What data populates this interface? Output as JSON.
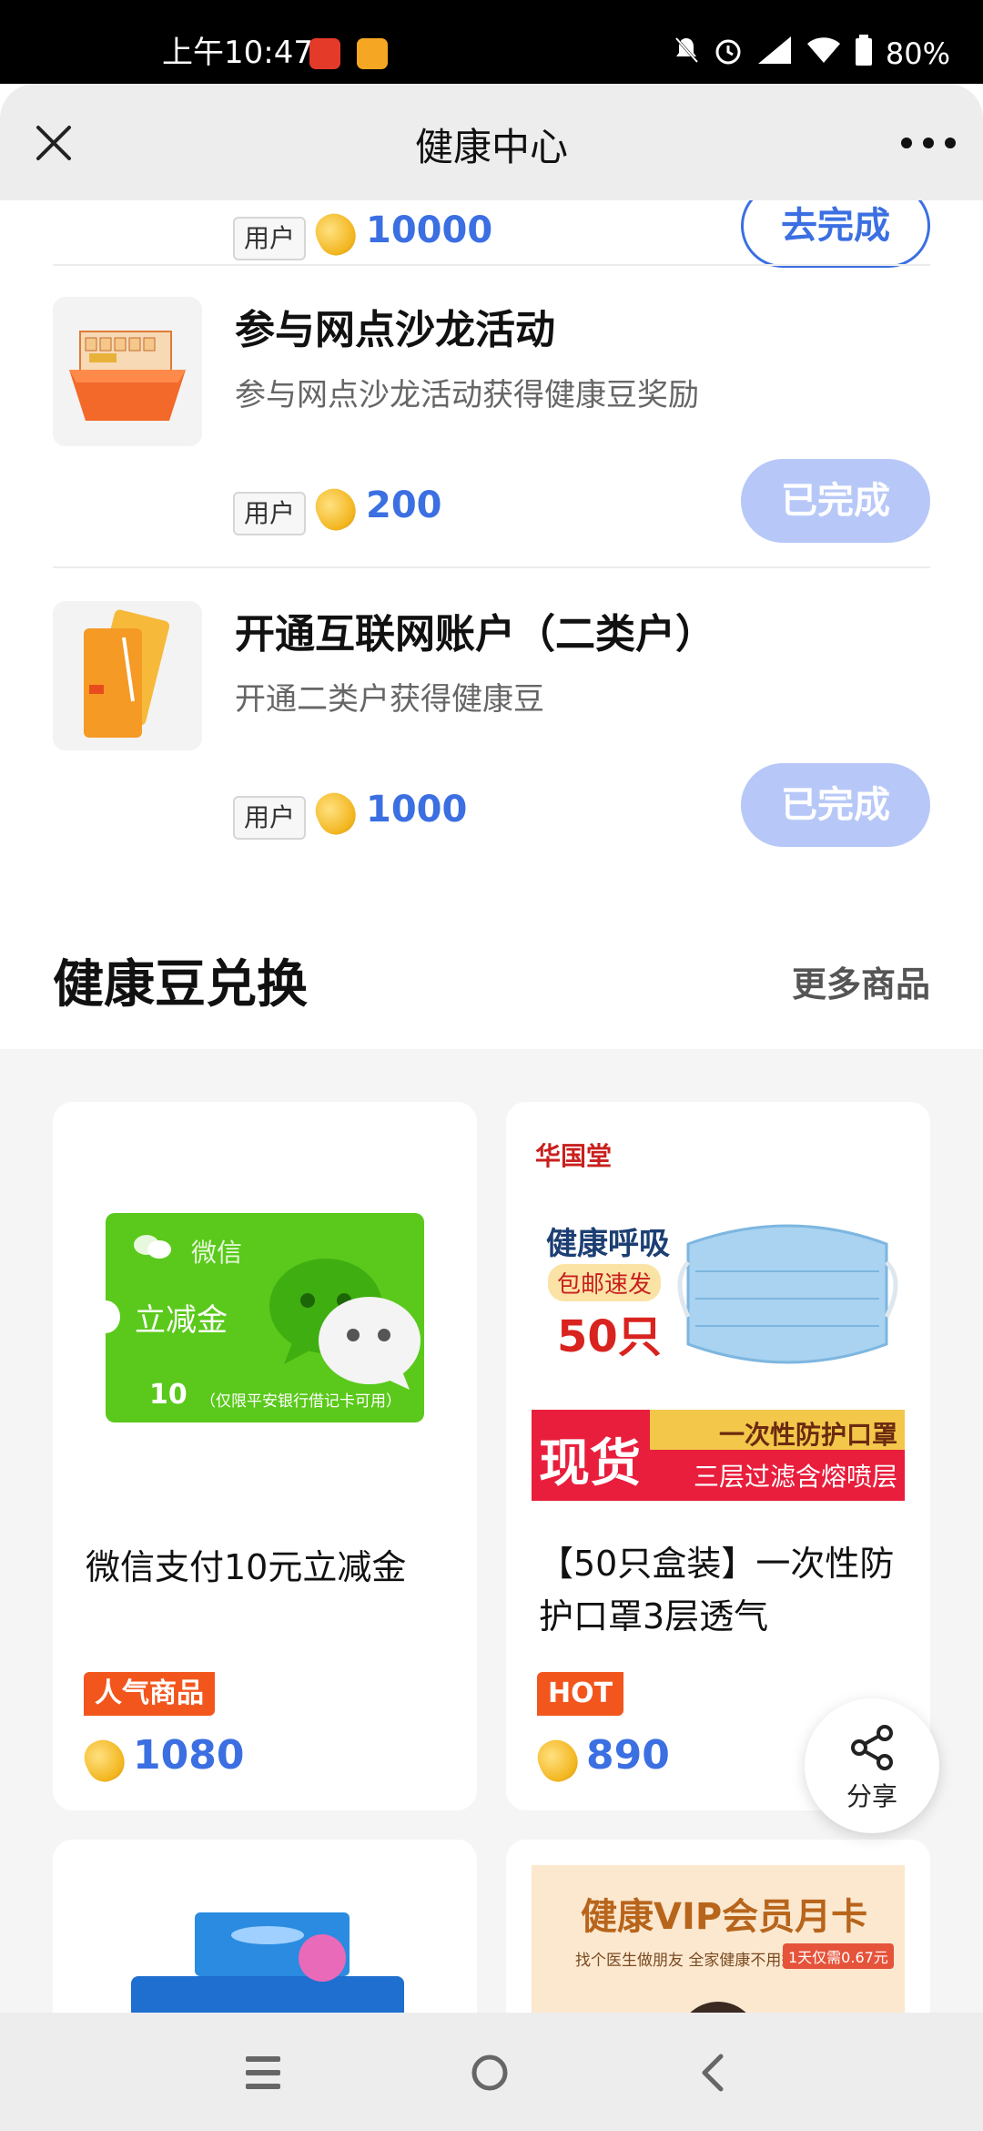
{
  "status_bar": {
    "time": "上午10:47",
    "battery": "80%"
  },
  "header": {
    "title": "健康中心"
  },
  "tasks": [
    {
      "tag": "用户",
      "points": "10000",
      "button": "去完成"
    },
    {
      "title": "参与网点沙龙活动",
      "desc": "参与网点沙龙活动获得健康豆奖励",
      "tag": "用户",
      "points": "200",
      "button": "已完成"
    },
    {
      "title": "开通互联网账户（二类户）",
      "desc": "开通二类户获得健康豆",
      "tag": "用户",
      "points": "1000",
      "button": "已完成"
    }
  ],
  "exchange": {
    "title": "健康豆兑换",
    "more": "更多商品"
  },
  "products": [
    {
      "name": "微信支付10元立减金",
      "badge": "人气商品",
      "points": "1080",
      "image": {
        "brand": "微信",
        "title": "立减金",
        "amount": "10",
        "note": "（仅限平安银行借记卡可用）"
      }
    },
    {
      "name": "【50只盒装】一次性防护口罩3层透气",
      "badge": "HOT",
      "points": "890",
      "image": {
        "brand": "华国堂",
        "line1": "健康呼吸",
        "line2": "包邮速发",
        "line3": "50只",
        "big": "现货",
        "banner1": "一次性防护口罩",
        "banner2": "三层过滤含熔喷层"
      }
    },
    {
      "name": "",
      "image": {}
    },
    {
      "name": "",
      "image": {
        "title": "健康VIP会员月卡",
        "sub": "找个医生做朋友 全家健康不用愁",
        "tag": "1天仅需0.67元"
      }
    }
  ],
  "share": {
    "label": "分享"
  },
  "colors": {
    "accent": "#3b6fe2",
    "done": "#b7c8f8",
    "badge": "#f2561d",
    "wechat_green": "#5ac91b"
  }
}
